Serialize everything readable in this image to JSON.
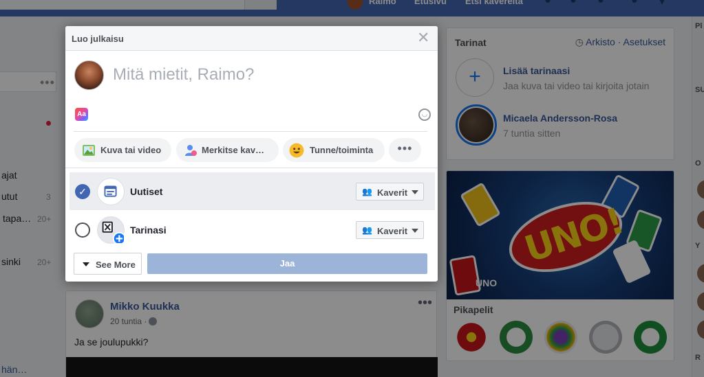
{
  "topbar": {
    "user_name": "Raimo",
    "home_label": "Etusivu",
    "find_friends_label": "Etsi kavereita"
  },
  "left_nav": {
    "items": [
      {
        "label": "ajat",
        "count": ""
      },
      {
        "label": "utut",
        "count": "3"
      },
      {
        "label": "tapa…",
        "count": "20+"
      },
      {
        "label": "sinki",
        "count": "20+"
      },
      {
        "label": "hän…",
        "count": ""
      }
    ]
  },
  "modal": {
    "title": "Luo julkaisu",
    "composer_placeholder": "Mitä mietit, Raimo?",
    "text_format_icon_label": "Aa",
    "actions": [
      {
        "label": "Kuva tai video",
        "icon": "photo-icon"
      },
      {
        "label": "Merkitse kav…",
        "icon": "tag-friends-icon"
      },
      {
        "label": "Tunne/toiminta",
        "icon": "feeling-icon"
      }
    ],
    "destinations": [
      {
        "label": "Uutiset",
        "checked": true,
        "audience": "Kaverit"
      },
      {
        "label": "Tarinasi",
        "checked": false,
        "audience": "Kaverit"
      }
    ],
    "see_more_label": "See More",
    "share_label": "Jaa"
  },
  "feed_post": {
    "author": "Mikko Kuukka",
    "time": "20 tuntia ·",
    "text": "Ja se joulupukki?"
  },
  "stories": {
    "title": "Tarinat",
    "archive_label": "Arkisto",
    "separator": "·",
    "settings_label": "Asetukset",
    "add_title": "Lisää tarinaasi",
    "add_subtitle": "Jaa kuva tai video tai kirjoita jotain",
    "story_author": "Micaela Andersson-Rosa",
    "story_time": "7 tuntia sitten"
  },
  "games": {
    "banner_label": "UNO",
    "banner_title": "UNO!",
    "section_title": "Pikapelit"
  },
  "colors": {
    "brand": "#4267b2",
    "link": "#385898",
    "share_disabled": "#9cb4d8"
  }
}
